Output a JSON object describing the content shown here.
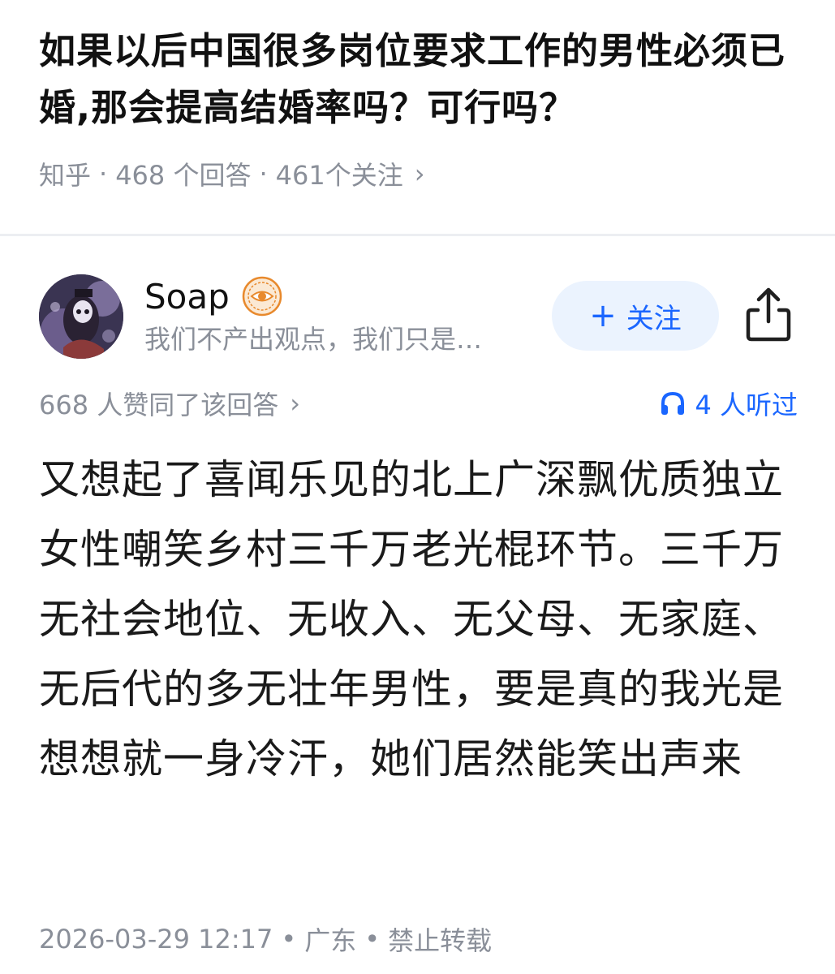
{
  "question": {
    "title": "如果以后中国很多岗位要求工作的男性必须已婚,那会提高结婚率吗？可行吗？",
    "source": "知乎",
    "separator": "·",
    "answer_count": "468 个回答",
    "follower_count": "461个关注",
    "chevron": "›"
  },
  "author": {
    "name": "Soap",
    "bio": "我们不产出观点，我们只是…",
    "follow_label": "关注",
    "follow_plus": "+",
    "badge_icon": "eye-badge-icon",
    "share_icon": "share-icon"
  },
  "stats": {
    "upvotes": "668 人赞同了该回答",
    "chevron": "›",
    "listeners": "4 人听过",
    "listen_icon": "headphones-icon"
  },
  "answer": {
    "text": "又想起了喜闻乐见的北上广深飘优质独立女性嘲笑乡村三千万老光棍环节。三千万无社会地位、无收入、无父母、无家庭、无后代的多无壮年男性，要是真的我光是想想就一身冷汗，她们居然能笑出声来"
  },
  "footer": {
    "datetime": "2026-03-29 12:17",
    "separator": "•",
    "location": "广东",
    "copyright": "禁止转载"
  },
  "colors": {
    "accent": "#1a66ff",
    "follow_bg": "#ebf3fe",
    "meta_gray": "#8a8f99",
    "badge_orange": "#e8892c"
  }
}
